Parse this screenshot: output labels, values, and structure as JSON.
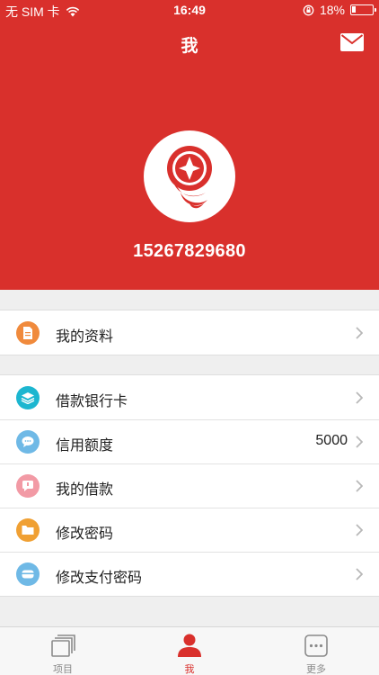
{
  "status_bar": {
    "carrier": "无 SIM 卡",
    "time": "16:49",
    "battery": "18%",
    "battery_level": 0.18
  },
  "header": {
    "title": "我",
    "phone": "15267829680"
  },
  "menu_group_1": [
    {
      "label": "我的资料",
      "value": "",
      "icon": "document-icon",
      "color": "#f08a3c"
    }
  ],
  "menu_group_2": [
    {
      "label": "借款银行卡",
      "value": "",
      "icon": "layers-icon",
      "color": "#1cb6d0"
    },
    {
      "label": "信用额度",
      "value": "5000",
      "icon": "chat-bubble-icon",
      "color": "#6fb9e6"
    },
    {
      "label": "我的借款",
      "value": "",
      "icon": "message-icon",
      "color": "#f29aa5"
    },
    {
      "label": "修改密码",
      "value": "",
      "icon": "folder-icon",
      "color": "#f0a033"
    },
    {
      "label": "修改支付密码",
      "value": "",
      "icon": "card-icon",
      "color": "#6fb9e6"
    }
  ],
  "tabs": [
    {
      "label": "项目",
      "icon": "stack-icon",
      "active": false
    },
    {
      "label": "我",
      "icon": "person-icon",
      "active": true
    },
    {
      "label": "更多",
      "icon": "more-icon",
      "active": false
    }
  ],
  "colors": {
    "brand_red": "#d9302c",
    "background": "#efefef"
  }
}
